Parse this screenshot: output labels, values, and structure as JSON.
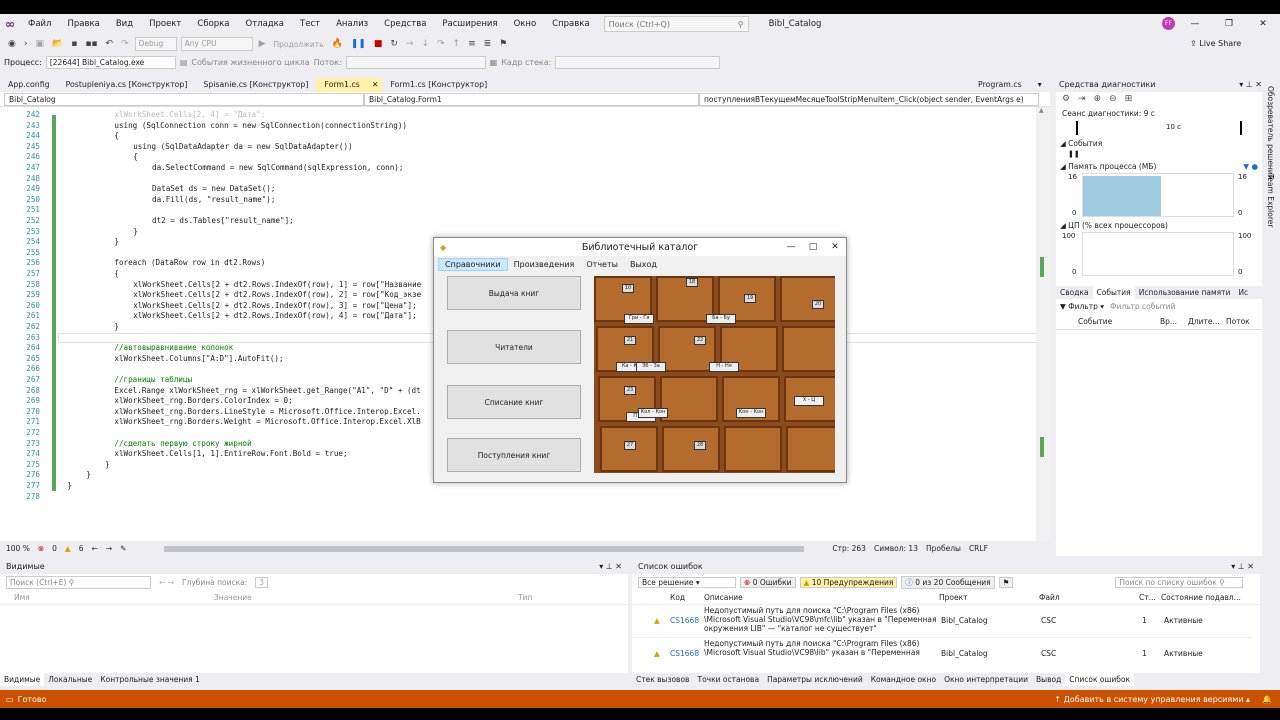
{
  "menu": {
    "items": [
      "Файл",
      "Правка",
      "Вид",
      "Проект",
      "Сборка",
      "Отладка",
      "Тест",
      "Анализ",
      "Средства",
      "Расширения",
      "Окно",
      "Справка"
    ],
    "search_placeholder": "Поиск (Ctrl+Q)",
    "solution_title": "Bibl_Catalog",
    "avatar_initials": "FF",
    "live_share": "Live Share"
  },
  "toolbar": {
    "config": "Debug",
    "platform": "Any CPU",
    "continue": "Продолжить"
  },
  "toolbar2": {
    "process_label": "Процесс:",
    "process_value": "[22644] Bibl_Catalog.exe",
    "lifecycle": "События жизненного цикла",
    "thread_label": "Поток:",
    "stack_label": "Кадр стека:"
  },
  "tabs": [
    "App.config",
    "Postupleniya.cs [Конструктор]",
    "Spisanie.cs [Конструктор]",
    "Form1.cs",
    "Form1.cs [Конструктор]"
  ],
  "tabs_right": [
    "Program.cs"
  ],
  "nav": {
    "project": "Bibl_Catalog",
    "class": "Bibl_Catalog.Form1",
    "member": "поступленияВТекущемМесяцеToolStripMenuItem_Click(object sender, EventArgs e)"
  },
  "code_lines": [
    {
      "n": "242",
      "t": "xlWorkSheet.Cells[2, 4] = \"Дата\";",
      "c": "fade",
      "i": 6
    },
    {
      "n": "243",
      "t": "using (SqlConnection conn = new SqlConnection(connectionString))",
      "c": "kw",
      "i": 6
    },
    {
      "n": "244",
      "t": "{",
      "c": "kw",
      "i": 6
    },
    {
      "n": "245",
      "t": "using (SqlDataAdapter da = new SqlDataAdapter())",
      "c": "kw",
      "i": 8
    },
    {
      "n": "246",
      "t": "{",
      "c": "kw",
      "i": 8
    },
    {
      "n": "247",
      "t": "da.SelectCommand = new SqlCommand(sqlExpression, conn);",
      "c": "kw",
      "i": 10
    },
    {
      "n": "248",
      "t": "",
      "c": "kw",
      "i": 10
    },
    {
      "n": "249",
      "t": "DataSet ds = new DataSet();",
      "c": "kw",
      "i": 10
    },
    {
      "n": "250",
      "t": "da.Fill(ds, \"result_name\");",
      "c": "kw",
      "i": 10
    },
    {
      "n": "251",
      "t": "",
      "c": "kw",
      "i": 10
    },
    {
      "n": "252",
      "t": "dt2 = ds.Tables[\"result_name\"];",
      "c": "kw",
      "i": 10
    },
    {
      "n": "253",
      "t": "}",
      "c": "kw",
      "i": 8
    },
    {
      "n": "254",
      "t": "}",
      "c": "kw",
      "i": 6
    },
    {
      "n": "255",
      "t": "",
      "c": "kw",
      "i": 6
    },
    {
      "n": "256",
      "t": "foreach (DataRow row in dt2.Rows)",
      "c": "kw",
      "i": 6
    },
    {
      "n": "257",
      "t": "{",
      "c": "kw",
      "i": 6
    },
    {
      "n": "258",
      "t": "xlWorkSheet.Cells[2 + dt2.Rows.IndexOf(row), 1] = row[\"Название",
      "c": "kw",
      "i": 8
    },
    {
      "n": "259",
      "t": "xlWorkSheet.Cells[2 + dt2.Rows.IndexOf(row), 2] = row[\"Код_экзе",
      "c": "kw",
      "i": 8
    },
    {
      "n": "260",
      "t": "xlWorkSheet.Cells[2 + dt2.Rows.IndexOf(row), 3] = row[\"Цена\"];",
      "c": "kw",
      "i": 8
    },
    {
      "n": "261",
      "t": "xlWorkSheet.Cells[2 + dt2.Rows.IndexOf(row), 4] = row[\"Дата\"];",
      "c": "kw",
      "i": 8
    },
    {
      "n": "262",
      "t": "}",
      "c": "kw",
      "i": 6
    },
    {
      "n": "263",
      "t": "",
      "c": "kw",
      "i": 6
    },
    {
      "n": "264",
      "t": "//автовыравнивание колонок",
      "c": "comment",
      "i": 6
    },
    {
      "n": "265",
      "t": "xlWorkSheet.Columns[\"A:D\"].AutoFit();",
      "c": "kw",
      "i": 6
    },
    {
      "n": "266",
      "t": "",
      "c": "kw",
      "i": 6
    },
    {
      "n": "267",
      "t": "//границы таблицы",
      "c": "comment",
      "i": 6
    },
    {
      "n": "268",
      "t": "Excel.Range xlWorkSheet_rng = xlWorkSheet.get_Range(\"A1\", \"D\" + (dt",
      "c": "kw",
      "i": 6
    },
    {
      "n": "269",
      "t": "xlWorkSheet_rng.Borders.ColorIndex = 0;",
      "c": "kw",
      "i": 6
    },
    {
      "n": "270",
      "t": "xlWorkSheet_rng.Borders.LineStyle = Microsoft.Office.Interop.Excel.",
      "c": "kw",
      "i": 6
    },
    {
      "n": "271",
      "t": "xlWorkSheet_rng.Borders.Weight = Microsoft.Office.Interop.Excel.XlB",
      "c": "kw",
      "i": 6
    },
    {
      "n": "272",
      "t": "",
      "c": "kw",
      "i": 6
    },
    {
      "n": "273",
      "t": "//сделать первую строку жирной",
      "c": "comment",
      "i": 6
    },
    {
      "n": "274",
      "t": "xlWorkSheet.Cells[1, 1].EntireRow.Font.Bold = true;",
      "c": "kw",
      "i": 6
    },
    {
      "n": "275",
      "t": "}",
      "c": "kw",
      "i": 5
    },
    {
      "n": "276",
      "t": "}",
      "c": "kw",
      "i": 3
    },
    {
      "n": "277",
      "t": "}",
      "c": "kw",
      "i": 1
    },
    {
      "n": "278",
      "t": "",
      "c": "kw",
      "i": 0
    }
  ],
  "editor_status": {
    "zoom": "100 %",
    "errors": "0",
    "warnings": "6",
    "line": "Стр: 263",
    "col": "Символ: 13",
    "spaces": "Пробелы",
    "eol": "CRLF"
  },
  "winform": {
    "title": "Библиотечный каталог",
    "menu": [
      "Справочники",
      "Произведения",
      "Отчеты",
      "Выход"
    ],
    "buttons": [
      "Выдача книг",
      "Читатели",
      "Списание книг",
      "Поступления книг"
    ],
    "drawer_labels": [
      "Гри - Гя",
      "Ба - Бу",
      "Ка - Ке",
      "Зб - За",
      "Н - Ня",
      "П - По",
      "Кол - Кон",
      "Кон - Кон",
      "Х - Ц"
    ],
    "drawer_numbers": [
      "10",
      "18",
      "19",
      "20",
      "21",
      "22",
      "23",
      "27",
      "28"
    ]
  },
  "diagnostics": {
    "title": "Средства диагностики",
    "session": "Сеанс диагностики: 9 с",
    "time_mark": "10 с",
    "events": "События",
    "memory": "Память процесса (МБ)",
    "memory_max": "16",
    "memory_min": "0",
    "cpu": "ЦП (% всех процессоров)",
    "cpu_max": "100",
    "cpu_min": "0",
    "tabs": [
      "Сводка",
      "События",
      "Использование памяти",
      "Ис"
    ],
    "filter": "Фильтр",
    "filter_placeholder": "Фильтр событий",
    "cols": [
      "Событие",
      "Вр...",
      "Длите...",
      "Поток"
    ]
  },
  "side_tabs": [
    "Обозреватель решений",
    "Team Explorer"
  ],
  "watch": {
    "title": "Видимые",
    "search_placeholder": "Поиск (Ctrl+E)",
    "depth_label": "Глубина поиска:",
    "depth_value": "3",
    "cols": [
      "Имя",
      "Значение",
      "Тип"
    ],
    "tabs": [
      "Видимые",
      "Локальные",
      "Контрольные значения 1"
    ]
  },
  "errors": {
    "title": "Список ошибок",
    "scope": "Все решение",
    "err_count": "0 Ошибки",
    "warn_count": "10 Предупреждения",
    "msg_count": "0 из 20 Сообщения",
    "search_placeholder": "Поиск по списку ошибок",
    "cols": [
      "Код",
      "Описание",
      "Проект",
      "Файл",
      "Ст...",
      "Состояние подавл..."
    ],
    "rows": [
      {
        "code": "CS1668",
        "desc1": "Недопустимый путь для поиска \"C:\\Program Files (x86)",
        "desc2": "\\Microsoft Visual Studio\\VC98\\mfc\\lib\" указан в \"Переменная",
        "desc3": "окружения LIB\" — \"каталог не существует\"",
        "project": "Bibl_Catalog",
        "file": "CSC",
        "line": "1",
        "state": "Активные"
      },
      {
        "code": "CS1668",
        "desc1": "Недопустимый путь для поиска \"C:\\Program Files (x86)",
        "desc2": "\\Microsoft Visual Studio\\VC98\\lib\" указан в \"Переменная",
        "desc3": "",
        "project": "Bibl_Catalog",
        "file": "CSC",
        "line": "1",
        "state": "Активные"
      }
    ],
    "tabs": [
      "Стек вызовов",
      "Точки останова",
      "Параметры исключений",
      "Командное окно",
      "Окно интерпретации",
      "Вывод",
      "Список ошибок"
    ]
  },
  "status": {
    "ready": "Готово",
    "vcs": "Добавить в систему управления версиями"
  }
}
